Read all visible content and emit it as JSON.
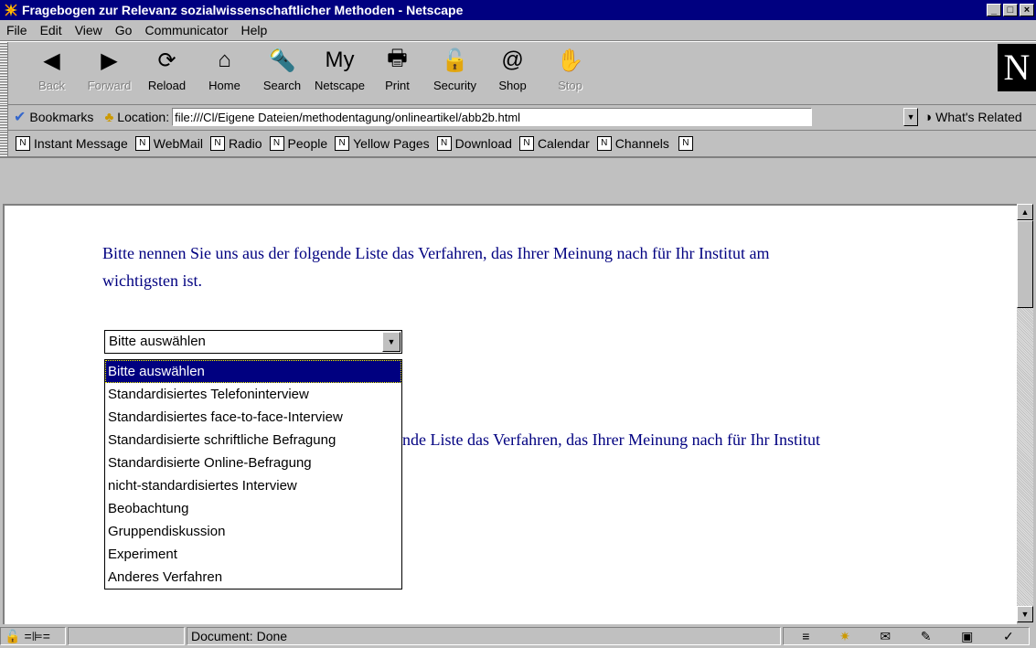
{
  "window": {
    "title": "Fragebogen zur Relevanz sozialwissenschaftlicher Methoden - Netscape",
    "min_label": "_",
    "max_label": "□",
    "close_label": "×"
  },
  "menu": [
    "File",
    "Edit",
    "View",
    "Go",
    "Communicator",
    "Help"
  ],
  "nav_buttons": [
    {
      "label": "Back",
      "icon": "back-icon",
      "glyph": "◀",
      "enabled": false
    },
    {
      "label": "Forward",
      "icon": "forward-icon",
      "glyph": "▶",
      "enabled": false
    },
    {
      "label": "Reload",
      "icon": "reload-icon",
      "glyph": "⟳",
      "enabled": true
    },
    {
      "label": "Home",
      "icon": "home-icon",
      "glyph": "⌂",
      "enabled": true
    },
    {
      "label": "Search",
      "icon": "search-icon",
      "glyph": "🔦",
      "enabled": true
    },
    {
      "label": "Netscape",
      "icon": "netscape-icon",
      "glyph": "My",
      "enabled": true
    },
    {
      "label": "Print",
      "icon": "print-icon",
      "glyph": "🖶",
      "enabled": true
    },
    {
      "label": "Security",
      "icon": "security-icon",
      "glyph": "🔓",
      "enabled": true
    },
    {
      "label": "Shop",
      "icon": "shop-icon",
      "glyph": "@",
      "enabled": true
    },
    {
      "label": "Stop",
      "icon": "stop-icon",
      "glyph": "✋",
      "enabled": false
    }
  ],
  "logo": "N",
  "location": {
    "bookmarks_label": "Bookmarks",
    "location_label": "Location:",
    "url": "file:///Cl/Eigene Dateien/methodentagung/onlineartikel/abb2b.html",
    "related_label": "What's Related"
  },
  "personal": [
    "Instant Message",
    "WebMail",
    "Radio",
    "People",
    "Yellow Pages",
    "Download",
    "Calendar",
    "Channels"
  ],
  "content": {
    "q1_line1": "Bitte nennen Sie uns aus der folgende Liste das Verfahren, das Ihrer Meinung nach für Ihr Institut am",
    "q1_line2": "wichtigsten ist.",
    "q2_line1": "nde Liste das Verfahren, das Ihrer Meinung nach für Ihr Institut",
    "select_value": "Bitte auswählen",
    "options": [
      "Bitte auswählen",
      "Standardisiertes Telefoninterview",
      "Standardisiertes face-to-face-Interview",
      "Standardisierte schriftliche  Befragung",
      "Standardisierte Online-Befragung",
      "nicht-standardisiertes Interview",
      "Beobachtung",
      "Gruppendiskussion",
      "Experiment",
      "Anderes Verfahren"
    ],
    "selected_index": 0
  },
  "status": {
    "text": "Document: Done"
  }
}
